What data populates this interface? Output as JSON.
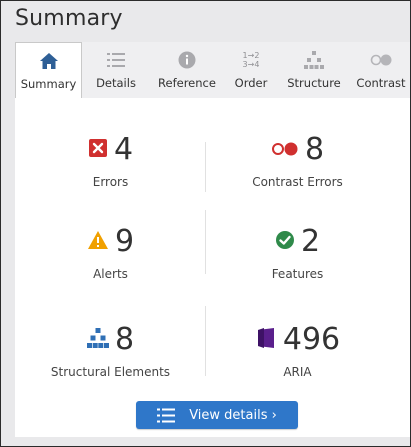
{
  "panel": {
    "title": "Summary"
  },
  "tabs": [
    {
      "label": "Summary",
      "icon": "home-icon",
      "active": true
    },
    {
      "label": "Details",
      "icon": "list-icon"
    },
    {
      "label": "Reference",
      "icon": "info-icon"
    },
    {
      "label": "Order",
      "icon": "order-icon",
      "icon_text": [
        "1→2",
        "3→4"
      ]
    },
    {
      "label": "Structure",
      "icon": "structure-icon"
    },
    {
      "label": "Contrast",
      "icon": "contrast-icon"
    }
  ],
  "stats": {
    "errors": {
      "count": "4",
      "label": "Errors",
      "icon": "error-icon"
    },
    "contrast_errors": {
      "count": "8",
      "label": "Contrast Errors",
      "icon": "contrast-error-icon"
    },
    "alerts": {
      "count": "9",
      "label": "Alerts",
      "icon": "alert-icon"
    },
    "features": {
      "count": "2",
      "label": "Features",
      "icon": "feature-icon"
    },
    "structural": {
      "count": "8",
      "label": "Structural Elements",
      "icon": "structure-icon"
    },
    "aria": {
      "count": "496",
      "label": "ARIA",
      "icon": "aria-icon"
    }
  },
  "view_details": {
    "label": "View details ›",
    "icon": "list-icon"
  },
  "colors": {
    "accent": "#2f77c9",
    "error": "#d0302f",
    "alert": "#f0a000",
    "feature": "#2f8a4a",
    "aria": "#5a1f8c",
    "structure": "#2f6fb5"
  }
}
